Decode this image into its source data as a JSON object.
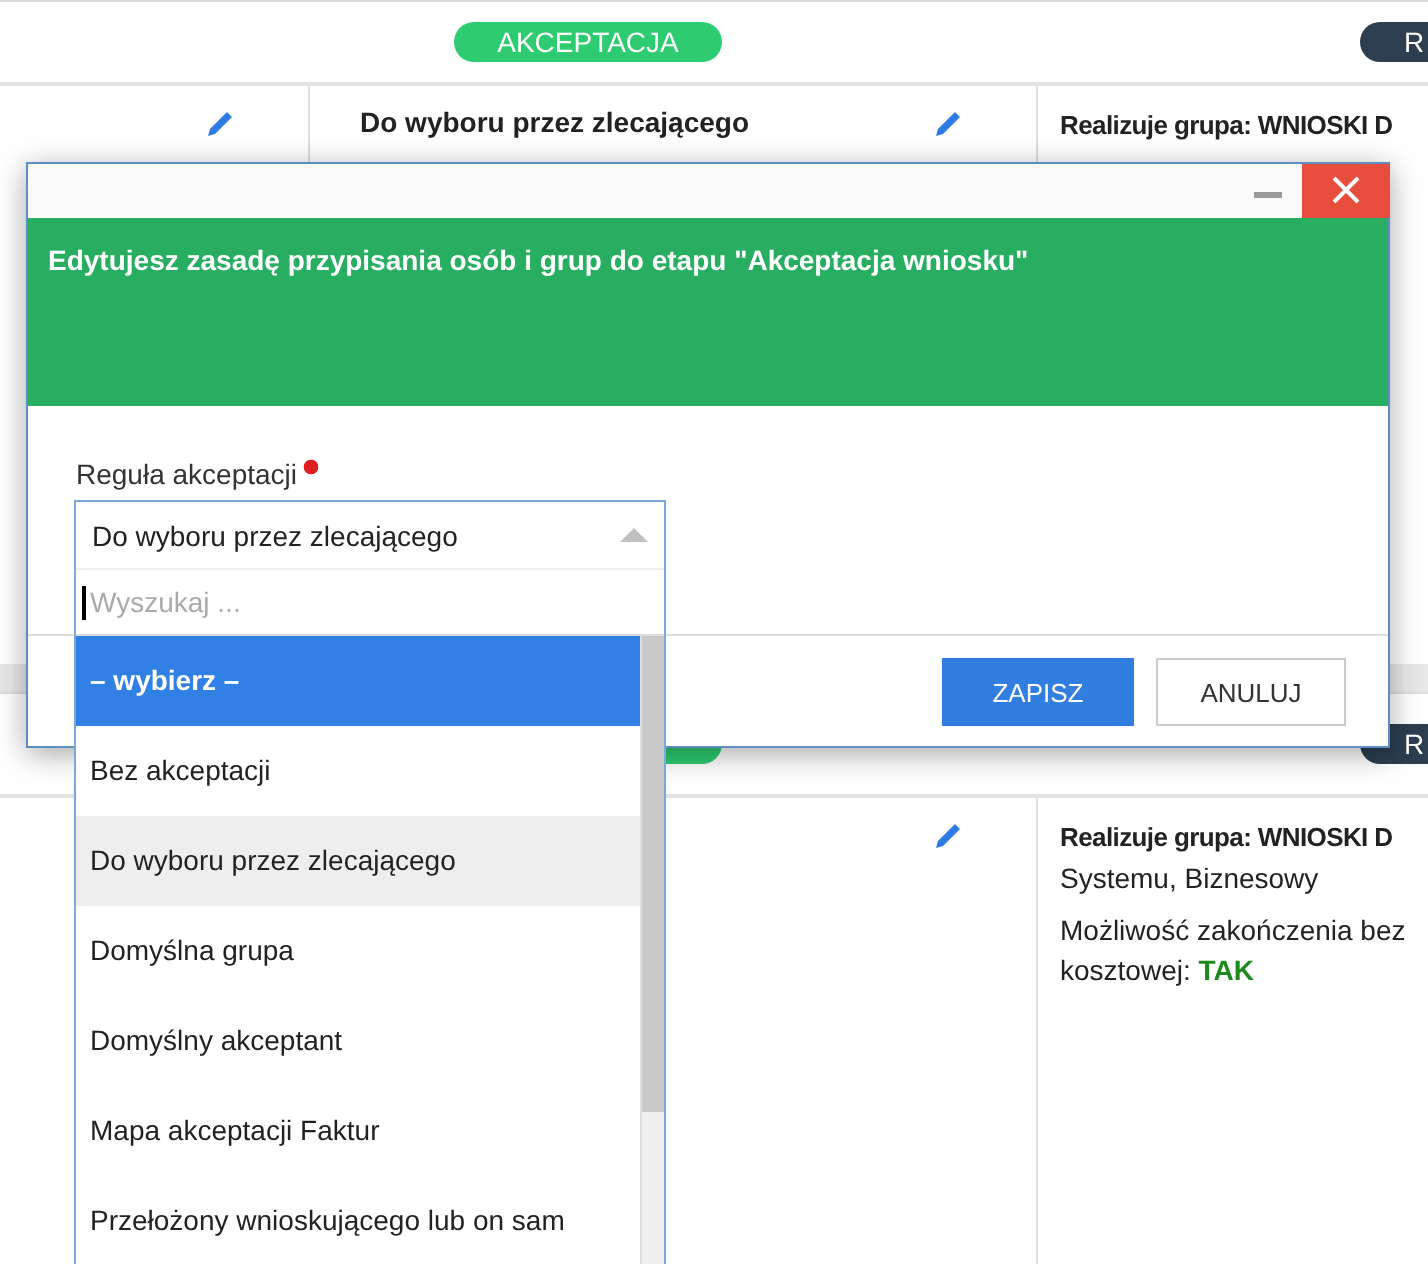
{
  "sections": [
    {
      "stage_pills": [
        {
          "kind": "accept",
          "label": "AKCEPTACJA"
        },
        {
          "kind": "realize",
          "label": "R"
        }
      ],
      "rule": "Do wyboru przez zlecającego",
      "first_column_edit": true,
      "details": [
        {
          "text": "Realizuje grupa: WNIOSKI D",
          "bold": true
        }
      ]
    },
    {
      "stage_pills": [
        {
          "kind": "accept"
        },
        {
          "kind": "realize",
          "label": "R"
        }
      ],
      "details": [
        {
          "text": "Realizuje grupa: WNIOSKI D",
          "bold": true
        },
        {
          "text": "Systemu, Biznesowy",
          "bold": false
        },
        {
          "text": "Możliwość zakończenia bez kosztowej: **TAK**",
          "bold": false
        }
      ]
    }
  ],
  "dialog": {
    "heading": "Edytujesz zasadę przypisania osób i grup do etapu \"Akceptacja wniosku\"",
    "field": {
      "label": "Reguła akceptacji",
      "required": true,
      "value": "Do wyboru przez zlecającego",
      "expanded": true,
      "search_placeholder": "Wyszukaj ...",
      "options": [
        {
          "label": "– wybierz –",
          "highlighted": true,
          "selected": false
        },
        {
          "label": "Bez akceptacji",
          "highlighted": false,
          "selected": false
        },
        {
          "label": "Do wyboru przez zlecającego",
          "highlighted": false,
          "selected": true
        },
        {
          "label": "Domyślna grupa",
          "highlighted": false,
          "selected": false
        },
        {
          "label": "Domyślny akceptant",
          "highlighted": false,
          "selected": false
        },
        {
          "label": "Mapa akceptacji Faktur",
          "highlighted": false,
          "selected": false
        },
        {
          "label": "Przełożony wnioskującego lub on sam",
          "highlighted": false,
          "selected": false
        }
      ]
    },
    "buttons": [
      {
        "label": "ZAPISZ",
        "kind": "primary"
      },
      {
        "label": "ANULUJ",
        "kind": "secondary"
      }
    ]
  }
}
